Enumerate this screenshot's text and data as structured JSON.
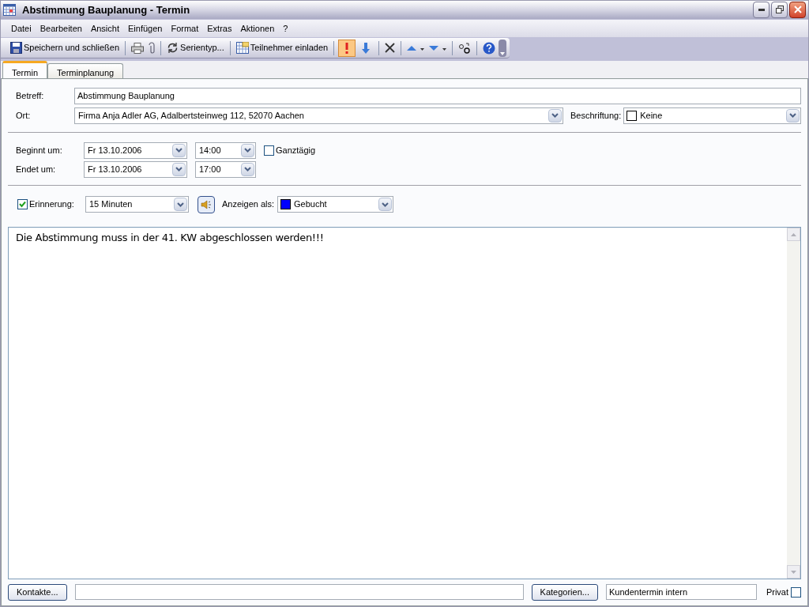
{
  "window": {
    "title": "Abstimmung Bauplanung - Termin"
  },
  "menu": [
    "Datei",
    "Bearbeiten",
    "Ansicht",
    "Einfügen",
    "Format",
    "Extras",
    "Aktionen",
    "?"
  ],
  "toolbar": {
    "save_label": "Speichern und schließen",
    "recurrence_label": "Serientyp...",
    "invite_label": "Teilnehmer einladen",
    "high_importance_pressed": true,
    "low_importance_pressed": false
  },
  "tabs": [
    {
      "label": "Termin",
      "selected": true
    },
    {
      "label": "Terminplanung",
      "selected": false
    }
  ],
  "subject": {
    "label": "Betreff:",
    "value": "Abstimmung Bauplanung"
  },
  "location": {
    "label": "Ort:",
    "value": "Firma Anja Adler AG, Adalbertsteinweg 112, 52070 Aachen"
  },
  "label_field": {
    "label": "Beschriftung:",
    "value": "Keine",
    "color": "#ffffff"
  },
  "start": {
    "label": "Beginnt um:",
    "date": "Fr 13.10.2006",
    "time": "14:00"
  },
  "end": {
    "label": "Endet um:",
    "date": "Fr 13.10.2006",
    "time": "17:00"
  },
  "all_day": {
    "label": "Ganztägig",
    "checked": false
  },
  "reminder": {
    "label": "Erinnerung:",
    "checked": true,
    "value": "15 Minuten"
  },
  "show_as": {
    "label": "Anzeigen als:",
    "value": "Gebucht",
    "color": "#0000ff"
  },
  "body": "Die Abstimmung muss in der 41. KW abgeschlossen werden!!!",
  "footer": {
    "contacts_button": "Kontakte...",
    "categories_button": "Kategorien...",
    "categories_value": "Kundentermin intern",
    "private": {
      "label": "Privat",
      "checked": false
    }
  }
}
